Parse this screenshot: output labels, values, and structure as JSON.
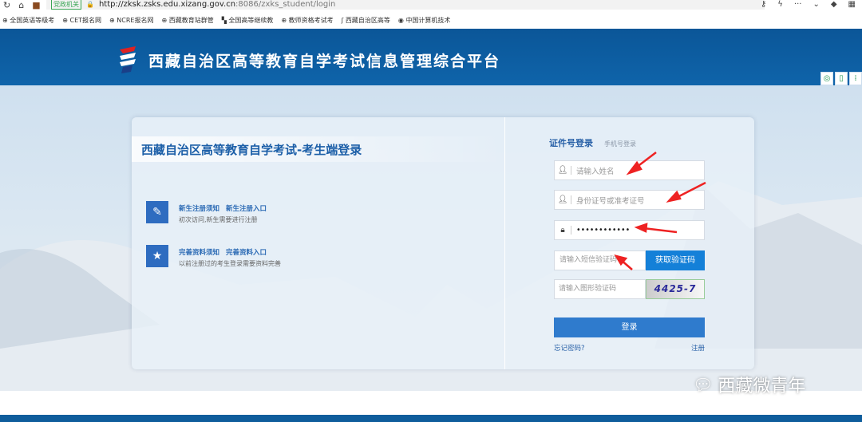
{
  "browser": {
    "gov_badge": "党政机关",
    "url_host": "http://zksk.zsks.edu.xizang.gov.cn",
    "url_path": ":8086/zxks_student/login",
    "bookmarks": [
      "全国英语等级考",
      "CET报名网",
      "NCRE报名网",
      "西藏教育站群管",
      "全国高等继续教",
      "教师资格考试考",
      "西藏自治区高等",
      "中国计算机技术"
    ]
  },
  "header": {
    "title": "西藏自治区高等教育自学考试信息管理综合平台"
  },
  "panel": {
    "title": "西藏自治区高等教育自学考试-考生端登录",
    "items": [
      {
        "link1": "新生注册须知",
        "link2": "新生注册入口",
        "desc": "初次访问,新生需要进行注册"
      },
      {
        "link1": "完善资料须知",
        "link2": "完善资料入口",
        "desc": "以前注册过的考生登录需要资料完善"
      }
    ]
  },
  "login": {
    "tab_id": "证件号登录",
    "tab_phone": "手机号登录",
    "name_placeholder": "请输入姓名",
    "id_placeholder": "身份证号或准考证号",
    "password_value": "••••••••••••",
    "sms_placeholder": "请输入短信验证码",
    "sms_button": "获取验证码",
    "captcha_placeholder": "请输入图形验证码",
    "captcha_text": "4425-7",
    "login_button": "登录",
    "forgot": "忘记密码?",
    "register": "注册"
  },
  "watermark": "西藏微青年",
  "colors": {
    "header": "#0b5698",
    "accent": "#2f7bcd",
    "arrow": "#ee2222"
  }
}
